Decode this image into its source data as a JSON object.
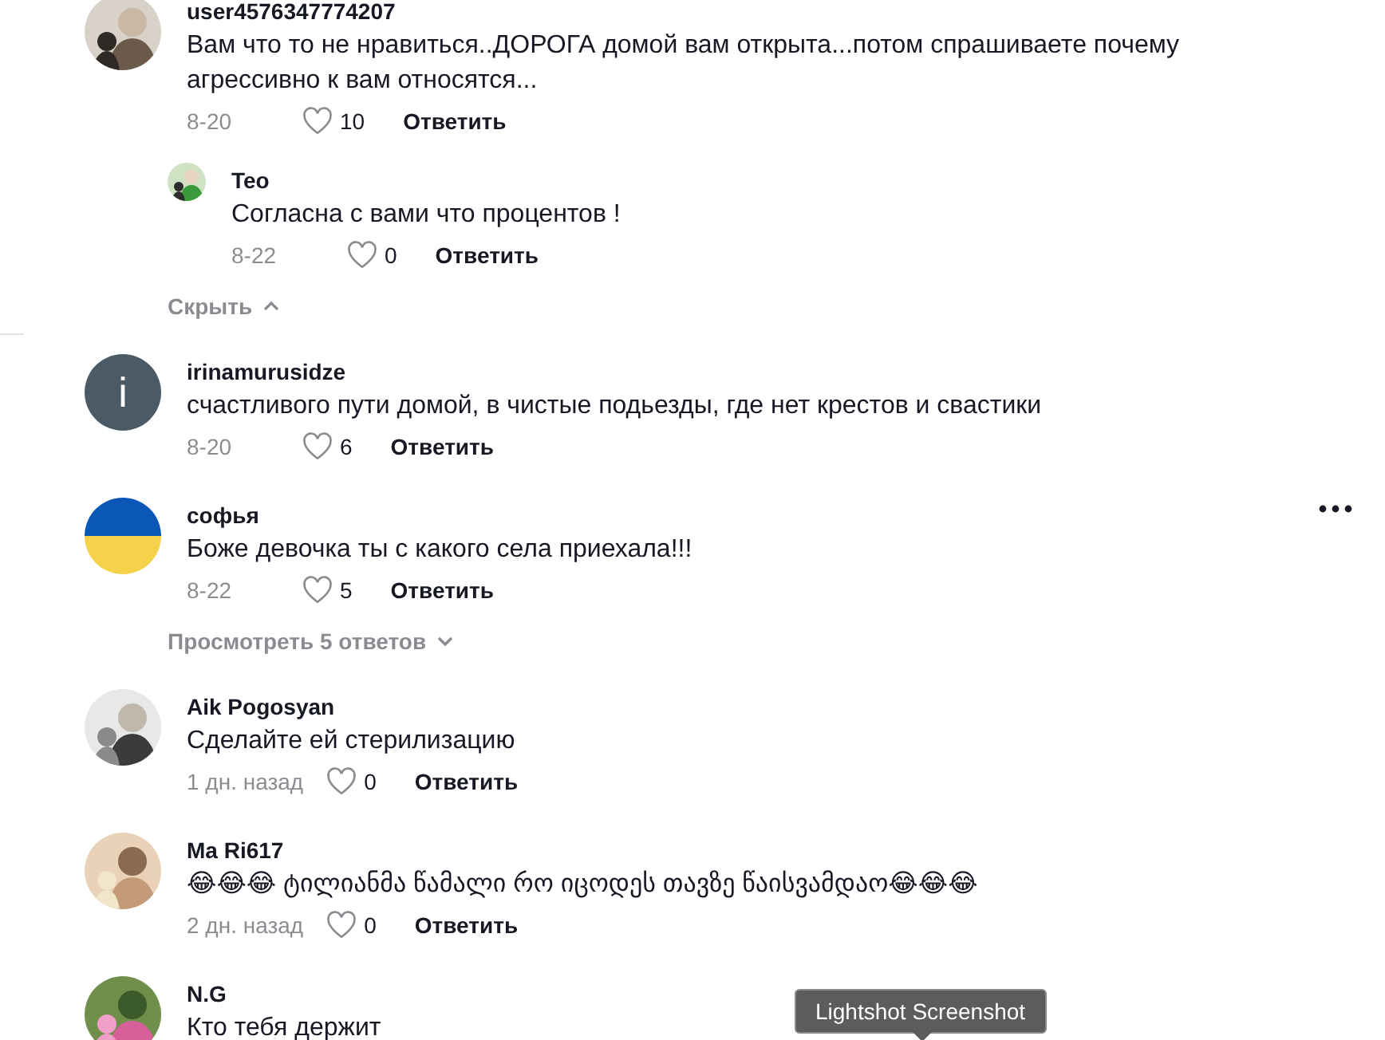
{
  "comments": [
    {
      "username": "user4576347774207",
      "text": "Вам что то не нравиться..ДОРОГА домой вам открыта...потом спрашиваете почему агрессивно к вам относятся...",
      "date": "8-20",
      "likes": "10",
      "reply": "Ответить",
      "replies": [
        {
          "username": "Teo",
          "text": "Согласна с вами что процентов !",
          "date": "8-22",
          "likes": "0",
          "reply": "Ответить"
        }
      ],
      "toggle": {
        "label": "Скрыть",
        "expanded": true
      }
    },
    {
      "avatar": {
        "kind": "letter",
        "letter": "i"
      },
      "username": "irinamurusidze",
      "text": "счастливого пути домой, в чистые подьезды, где нет крестов и свастики",
      "date": "8-20",
      "likes": "6",
      "reply": "Ответить"
    },
    {
      "avatar": {
        "kind": "flag"
      },
      "username": "софья",
      "text": "Боже девочка ты с какого села приехала!!!",
      "date": "8-22",
      "likes": "5",
      "reply": "Ответить",
      "more_menu": true,
      "toggle": {
        "label": "Просмотреть 5 ответов",
        "expanded": false
      }
    },
    {
      "username": "Aik Pogosyan",
      "text": "Сделайте ей стерилизацию",
      "date": "1 дн. назад",
      "likes": "0",
      "reply": "Ответить"
    },
    {
      "username": "Ma Ri617",
      "text": "😂😂😂 ტილიანმა წამალი რო იცოდეს თავზე წაისვამდაო😂😂😂",
      "date": "2 дн. назад",
      "likes": "0",
      "reply": "Ответить"
    },
    {
      "username": "N.G",
      "text": "Кто тебя держит"
    }
  ],
  "tooltip": "Lightshot Screenshot"
}
